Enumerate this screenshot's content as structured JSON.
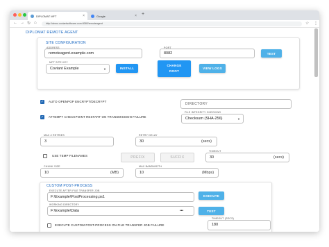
{
  "browser": {
    "tabs": [
      {
        "label": "DIPLOMAT MFT",
        "close": "×"
      },
      {
        "label": "Google",
        "close": "×"
      }
    ],
    "new_tab": "+",
    "url": "http://demo.coviantsoftware.com:8080/remoteagent",
    "nav": {
      "back": "←",
      "forward": "→",
      "reload": "↻",
      "home": "⌂"
    },
    "star": "☆",
    "menu": "⋮"
  },
  "page": {
    "title": "DIPLOMAT REMOTE AGENT",
    "site_config": {
      "title": "SITE CONFIGURATION",
      "address_label": "ADDRESS",
      "address_value": "remoteagent.example.com",
      "port_label": "PORT",
      "port_value": "8082",
      "test_button": "TEST",
      "key_label": "MFT SITE KEY",
      "key_value": "Coviant Example",
      "install_button": "INSTALL",
      "change_root_button": "CHANGE ROOT",
      "view_logs_button": "VIEW LOGS"
    },
    "options": {
      "auto_openpgp": "AUTO OPENPGP ENCRYPT/DECRYPT",
      "auto_openpgp_checked": true,
      "checkpoint_restart": "ATTEMPT CHECKPOINT RESTART ON TRANSMISSION FAILURE",
      "checkpoint_restart_checked": true,
      "directory_placeholder": "DIRECTORY",
      "integrity_label": "FILE INTEGRITY CHECKING",
      "integrity_value": "Checksum (SHA-256)"
    },
    "transfer": {
      "max_retries_label": "MAX # RETRIES",
      "max_retries_value": "3",
      "retry_delay_label": "RETRY DELAY",
      "retry_delay_value": "30",
      "retry_delay_unit": "(secs)",
      "temp_filenames": "USE TEMP FILENAMES",
      "temp_filenames_checked": false,
      "prefix_label": "PREFIX",
      "suffix_label": "SUFFIX",
      "timeout_label": "TIMEOUT",
      "timeout_value": "30",
      "timeout_unit": "(secs)",
      "chunk_size_label": "CHUNK SIZE",
      "chunk_size_value": "10",
      "chunk_size_unit": "(MB)",
      "max_bandwidth_label": "MAX BANDWIDTH",
      "max_bandwidth_value": "10",
      "max_bandwidth_unit": "(Mbps)"
    },
    "post_process": {
      "title": "CUSTOM POST-PROCESS",
      "execute_label": "EXECUTE AFTER FILE TRANSFER JOB",
      "execute_value": "F:\\Example\\PostProcessing.ps1",
      "execute_button": "EXECUTE",
      "workdir_label": "WORKING DIRECTORY",
      "workdir_value": "F:\\Example\\Data",
      "workdir_more": "•••",
      "test_button": "TEST",
      "on_failure": "EXECUTE CUSTOM POST-PROCESS ON FILE TRANSFER JOB FAILURE",
      "on_failure_checked": false,
      "timeout_label": "TIMEOUT (SECS)",
      "timeout_value": "180"
    }
  },
  "colors": {
    "accent": "#2196f3",
    "header_blue": "#1565c0",
    "checkbox": "#1e66b3"
  },
  "icons": {
    "check": "✓",
    "caret": "▼"
  }
}
